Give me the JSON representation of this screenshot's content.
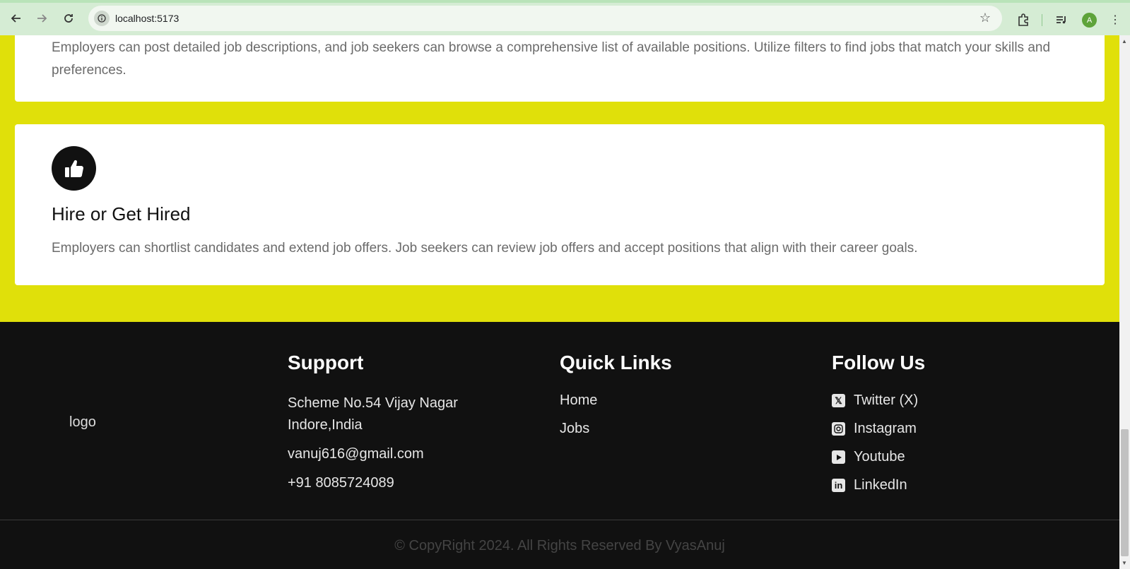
{
  "browser": {
    "url": "localhost:5173",
    "profile_initial": "A"
  },
  "cards": {
    "card1_text": "Employers can post detailed job descriptions, and job seekers can browse a comprehensive list of available positions. Utilize filters to find jobs that match your skills and preferences.",
    "card2_title": "Hire or Get Hired",
    "card2_text": "Employers can shortlist candidates and extend job offers. Job seekers can review job offers and accept positions that align with their career goals."
  },
  "footer": {
    "logo_alt": "logo",
    "support": {
      "title": "Support",
      "address_line1": "Scheme No.54 Vijay Nagar",
      "address_line2": "Indore,India",
      "email": "vanuj616@gmail.com",
      "phone": "+91 8085724089"
    },
    "quick_links": {
      "title": "Quick Links",
      "items": [
        "Home",
        "Jobs"
      ]
    },
    "follow_us": {
      "title": "Follow Us",
      "items": [
        {
          "label": "Twitter (X)",
          "icon": "twitter-x-icon"
        },
        {
          "label": "Instagram",
          "icon": "instagram-icon"
        },
        {
          "label": "Youtube",
          "icon": "youtube-icon"
        },
        {
          "label": "LinkedIn",
          "icon": "linkedin-icon"
        }
      ]
    },
    "copyright": "© CopyRight 2024. All Rights Reserved By VyasAnuj"
  },
  "colors": {
    "accent": "#e0e00a",
    "footer_bg": "#111111",
    "card_bg": "#ffffff"
  }
}
